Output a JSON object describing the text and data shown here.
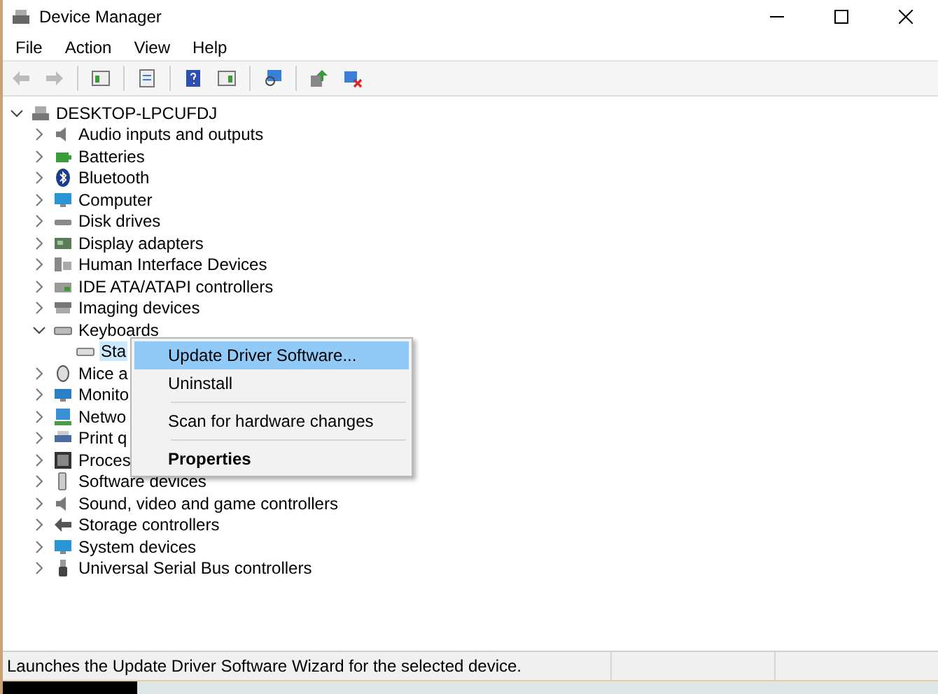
{
  "window": {
    "title": "Device Manager"
  },
  "menu": [
    "File",
    "Action",
    "View",
    "Help"
  ],
  "toolbar": [
    {
      "kind": "back",
      "disabled": true
    },
    {
      "kind": "forward",
      "disabled": true
    },
    {
      "kind": "sep"
    },
    {
      "kind": "tree",
      "disabled": false
    },
    {
      "kind": "sep"
    },
    {
      "kind": "props",
      "disabled": false
    },
    {
      "kind": "sep"
    },
    {
      "kind": "help",
      "disabled": false
    },
    {
      "kind": "pane",
      "disabled": false
    },
    {
      "kind": "sep"
    },
    {
      "kind": "scan",
      "disabled": false
    },
    {
      "kind": "sep"
    },
    {
      "kind": "update",
      "disabled": false
    },
    {
      "kind": "uninstall",
      "disabled": false
    }
  ],
  "tree": {
    "label": "DESKTOP-LPCUFDJ",
    "expanded": true,
    "children": [
      {
        "label": "Audio inputs and outputs",
        "expanded": false
      },
      {
        "label": "Batteries",
        "expanded": false
      },
      {
        "label": "Bluetooth",
        "expanded": false
      },
      {
        "label": "Computer",
        "expanded": false
      },
      {
        "label": "Disk drives",
        "expanded": false
      },
      {
        "label": "Display adapters",
        "expanded": false
      },
      {
        "label": "Human Interface Devices",
        "expanded": false
      },
      {
        "label": "IDE ATA/ATAPI controllers",
        "expanded": false
      },
      {
        "label": "Imaging devices",
        "expanded": false
      },
      {
        "label": "Keyboards",
        "expanded": true,
        "children": [
          {
            "label": "Sta",
            "selected": true
          }
        ]
      },
      {
        "label": "Mice a",
        "expanded": false
      },
      {
        "label": "Monito",
        "expanded": false
      },
      {
        "label": "Netwo",
        "expanded": false
      },
      {
        "label": "Print q",
        "expanded": false
      },
      {
        "label": "Proces",
        "expanded": false
      },
      {
        "label": "Software devices",
        "expanded": false
      },
      {
        "label": "Sound, video and game controllers",
        "expanded": false
      },
      {
        "label": "Storage controllers",
        "expanded": false
      },
      {
        "label": "System devices",
        "expanded": false
      },
      {
        "label": "Universal Serial Bus controllers",
        "expanded": false
      }
    ]
  },
  "context_menu": [
    {
      "kind": "item",
      "label": "Update Driver Software...",
      "selected": true,
      "bold": false
    },
    {
      "kind": "item",
      "label": "Uninstall",
      "selected": false,
      "bold": false
    },
    {
      "kind": "separator"
    },
    {
      "kind": "item",
      "label": "Scan for hardware changes",
      "selected": false,
      "bold": false
    },
    {
      "kind": "separator"
    },
    {
      "kind": "item",
      "label": "Properties",
      "selected": false,
      "bold": true
    }
  ],
  "status_bar": "Launches the Update Driver Software Wizard for the selected device."
}
